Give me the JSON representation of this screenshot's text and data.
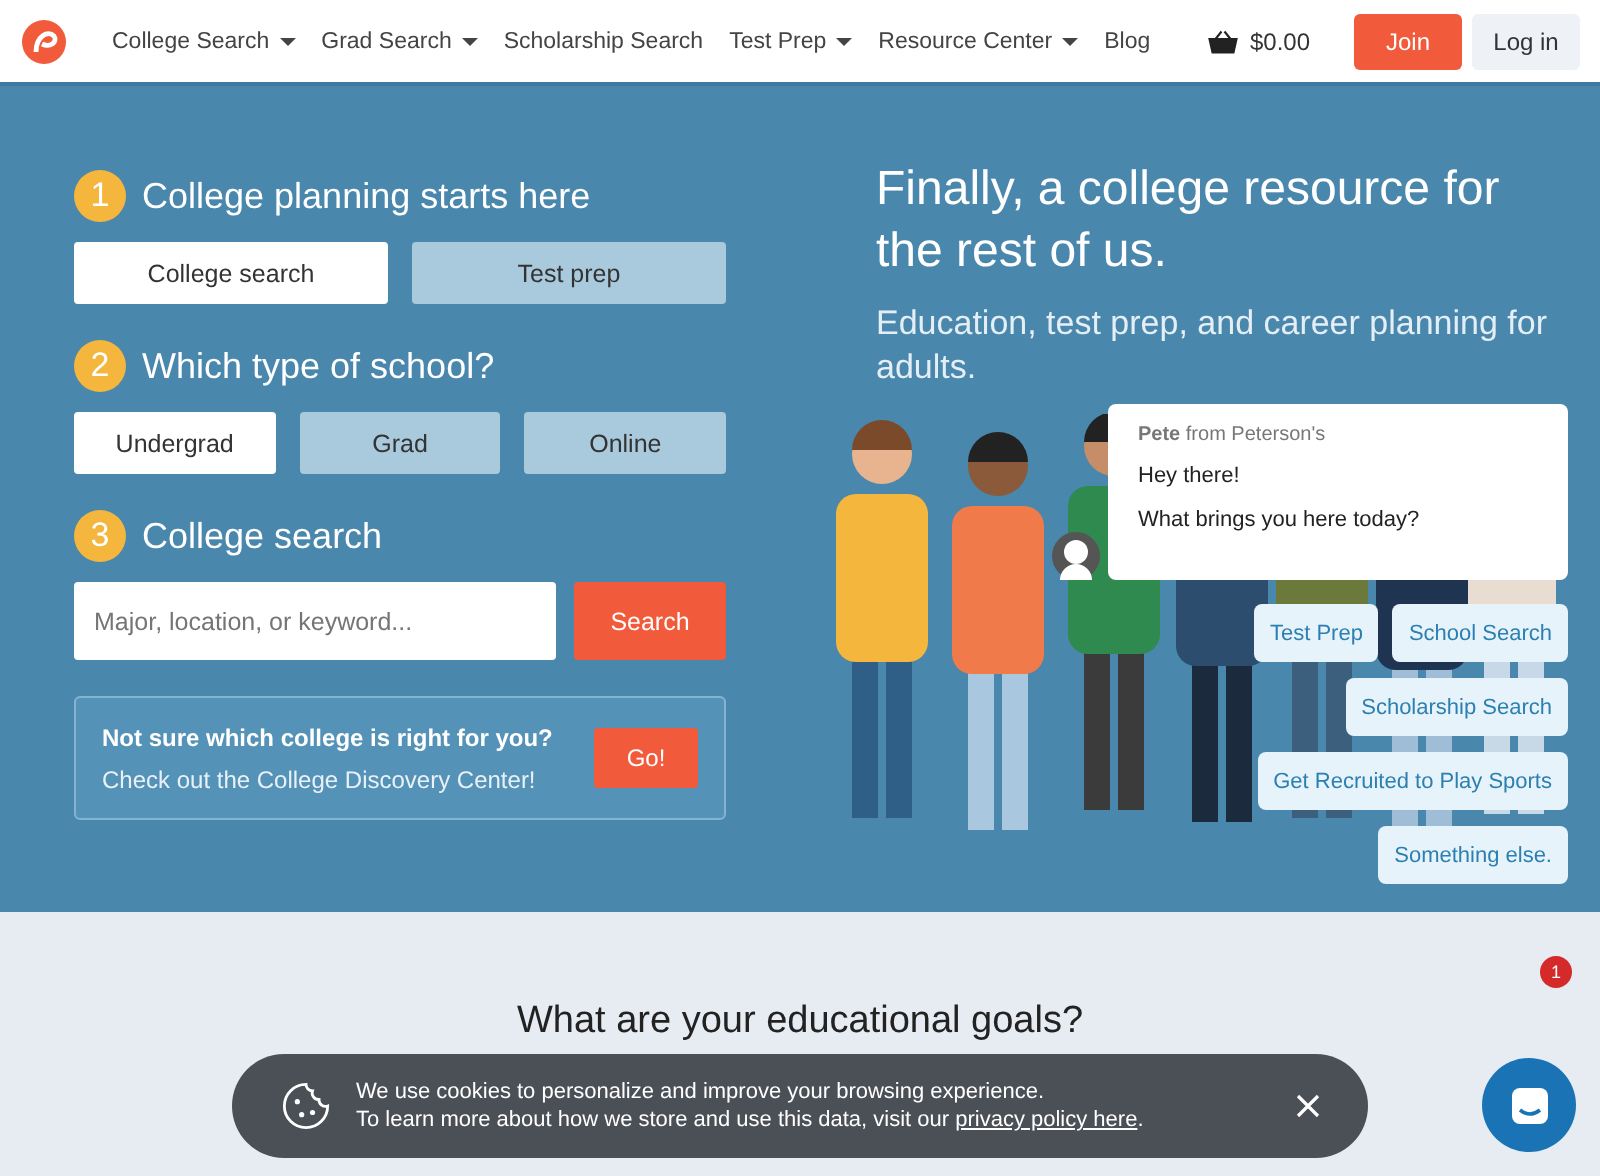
{
  "nav": {
    "items": [
      {
        "label": "College Search",
        "dropdown": true
      },
      {
        "label": "Grad Search",
        "dropdown": true
      },
      {
        "label": "Scholarship Search",
        "dropdown": false
      },
      {
        "label": "Test Prep",
        "dropdown": true
      },
      {
        "label": "Resource Center",
        "dropdown": true
      },
      {
        "label": "Blog",
        "dropdown": false
      }
    ],
    "cart": "$0.00",
    "join": "Join",
    "login": "Log in"
  },
  "steps": [
    {
      "number": "1",
      "title": "College planning starts here",
      "options": [
        {
          "label": "College search",
          "selected": true
        },
        {
          "label": "Test prep",
          "selected": false
        }
      ]
    },
    {
      "number": "2",
      "title": "Which type of school?",
      "options": [
        {
          "label": "Undergrad",
          "selected": true
        },
        {
          "label": "Grad",
          "selected": false
        },
        {
          "label": "Online",
          "selected": false
        }
      ]
    },
    {
      "number": "3",
      "title": "College search"
    }
  ],
  "search": {
    "placeholder": "Major, location, or keyword...",
    "button": "Search"
  },
  "discovery": {
    "title": "Not sure which college is right for you?",
    "text": "Check out the College Discovery Center!",
    "button": "Go!"
  },
  "headline": "Finally, a college resource for the rest of us.",
  "subheadline": "Education, test prep, and career planning for adults.",
  "chat": {
    "sender": "Pete",
    "from": "from Peterson's",
    "messages": [
      "Hey there!",
      "What brings you here today?"
    ],
    "replies": [
      [
        "Test Prep",
        "School Search"
      ],
      [
        "Scholarship Search"
      ],
      [
        "Get Recruited to Play Sports"
      ],
      [
        "Something else."
      ]
    ],
    "badge": "1"
  },
  "goals": {
    "heading": "What are your educational goals?"
  },
  "cookie": {
    "line1": "We use cookies to personalize and improve your browsing experience.",
    "line2": "To learn more about how we store and use this data, visit our",
    "link": "privacy policy here",
    "end": "."
  }
}
